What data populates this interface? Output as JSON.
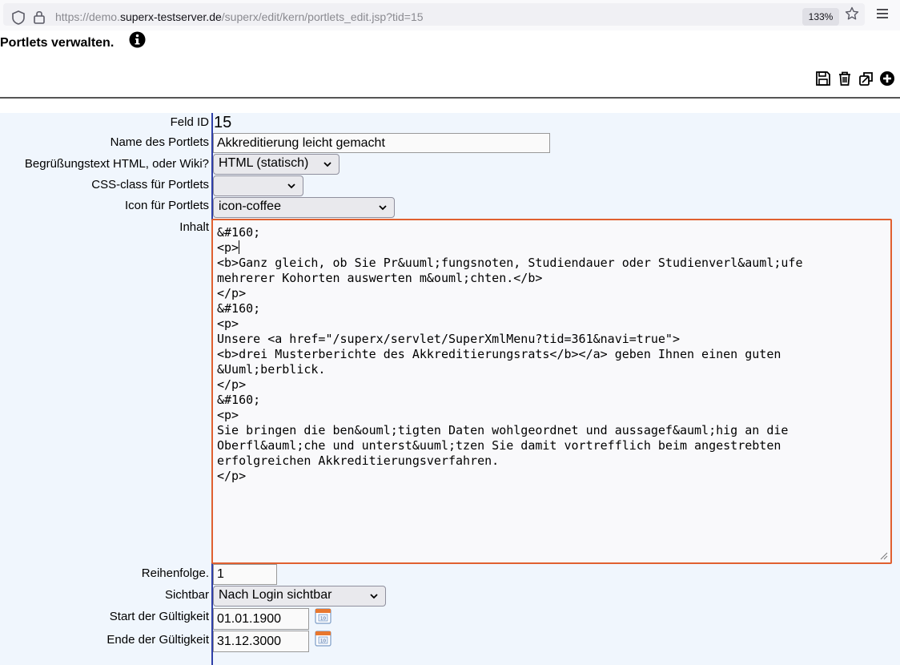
{
  "browser": {
    "url_prefix": "https://demo.",
    "url_host": "superx-testserver.de",
    "url_path": "/superx/edit/kern/portlets_edit.jsp?tid=15",
    "zoom": "133%"
  },
  "page": {
    "title": "Portlets verwalten."
  },
  "form": {
    "feld_id_label": "Feld ID",
    "feld_id_value": "15",
    "name_label": "Name des Portlets",
    "name_value": "Akkreditierung leicht gemacht",
    "greeting_label": "Begrüßungstext HTML, oder Wiki?",
    "greeting_value": "HTML (statisch)",
    "css_label": "CSS-class für Portlets",
    "css_value": "",
    "icon_label": "Icon für Portlets",
    "icon_value": "icon-coffee",
    "inhalt_label": "Inhalt",
    "inhalt_before_caret": "&#160;\n<p>",
    "inhalt_after_caret": "\n<b>Ganz gleich, ob Sie Pr&uuml;fungsnoten, Studiendauer oder Studienverl&auml;ufe\nmehrerer Kohorten auswerten m&ouml;chten.</b>\n</p>\n&#160;\n<p>\nUnsere <a href=\"/superx/servlet/SuperXmlMenu?tid=361&navi=true\">\n<b>drei Musterberichte des Akkreditierungsrats</b></a> geben Ihnen einen guten\n&Uuml;berblick.\n</p>\n&#160;\n<p>\nSie bringen die ben&ouml;tigten Daten wohlgeordnet und aussagef&auml;hig an die\nOberfl&auml;che und unterst&uuml;tzen Sie damit vortrefflich beim angestrebten\nerfolgreichen Akkreditierungsverfahren.\n</p>",
    "reihenfolge_label": "Reihenfolge.",
    "reihenfolge_value": "1",
    "sichtbar_label": "Sichtbar",
    "sichtbar_value": "Nach Login sichtbar",
    "start_label": "Start der Gültigkeit",
    "start_value": "01.01.1900",
    "ende_label": "Ende der Gültigkeit",
    "ende_value": "31.12.3000"
  },
  "icons": {
    "toolbar": [
      "save-icon",
      "delete-icon",
      "copy-icon",
      "add-icon"
    ],
    "calendar": "calendar-icon"
  },
  "colors": {
    "form_background": "#f0f6fd",
    "focus_border": "#e06030",
    "separator": "#2f3fa8"
  }
}
